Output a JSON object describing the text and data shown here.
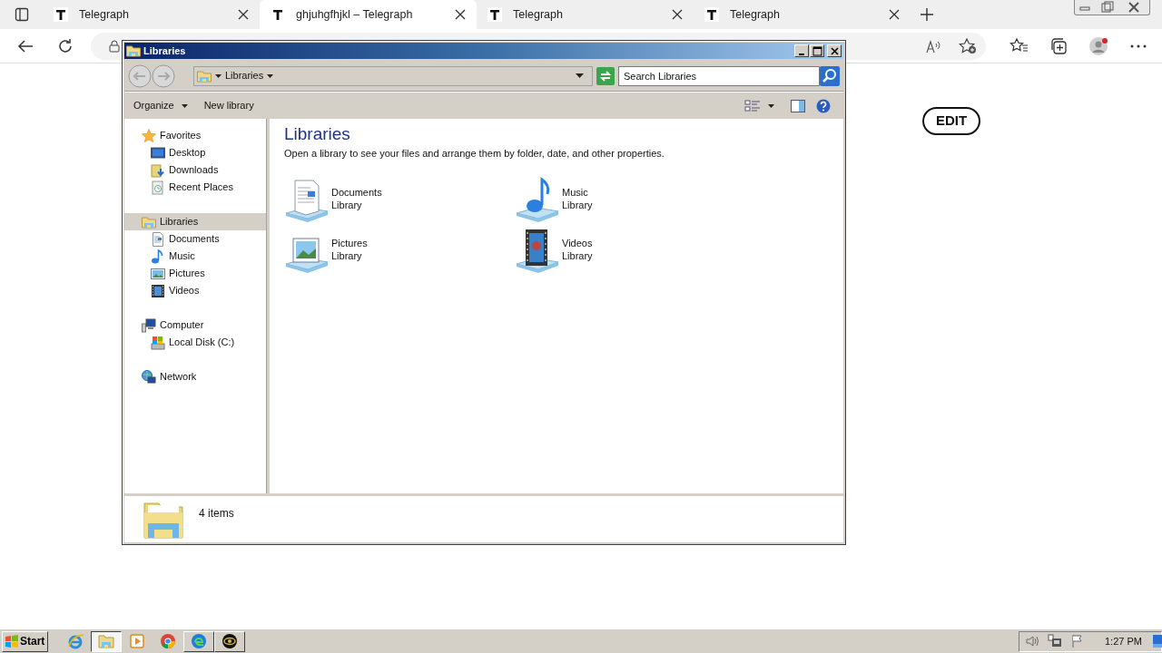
{
  "browser": {
    "tabs": [
      {
        "title": "Telegraph",
        "selected": false
      },
      {
        "title": "ghjuhgfhjkl – Telegraph",
        "selected": true
      },
      {
        "title": "Telegraph",
        "selected": false
      },
      {
        "title": "Telegraph",
        "selected": false
      }
    ]
  },
  "page": {
    "edit_button": "EDIT"
  },
  "explorer": {
    "title": "Libraries",
    "address": "Libraries",
    "search": {
      "placeholder": "Search Libraries"
    },
    "toolbar": [
      {
        "label": "Organize",
        "menu": true
      },
      {
        "label": "New library",
        "menu": false
      }
    ],
    "nav": [
      {
        "label": "Favorites",
        "kind": "star",
        "selected": false,
        "children": [
          {
            "label": "Desktop",
            "kind": "desktop",
            "selected": false
          },
          {
            "label": "Downloads",
            "kind": "downloads",
            "selected": false
          },
          {
            "label": "Recent Places",
            "kind": "recent",
            "selected": false
          }
        ]
      },
      {
        "label": "Libraries",
        "kind": "library",
        "selected": true,
        "children": [
          {
            "label": "Documents",
            "kind": "document",
            "selected": false
          },
          {
            "label": "Music",
            "kind": "music",
            "selected": false
          },
          {
            "label": "Pictures",
            "kind": "picture",
            "selected": false
          },
          {
            "label": "Videos",
            "kind": "video",
            "selected": false
          }
        ]
      },
      {
        "label": "Computer",
        "kind": "computer",
        "selected": false,
        "children": [
          {
            "label": "Local Disk (C:)",
            "kind": "disk",
            "selected": false
          }
        ]
      },
      {
        "label": "Network",
        "kind": "network",
        "selected": false
      }
    ],
    "heading": "Libraries",
    "description": "Open a library to see your files and arrange them by folder, date, and other properties.",
    "libraries": [
      {
        "name": "Documents",
        "subtitle": "Library",
        "kind": "document"
      },
      {
        "name": "Music",
        "subtitle": "Library",
        "kind": "music"
      },
      {
        "name": "Pictures",
        "subtitle": "Library",
        "kind": "picture"
      },
      {
        "name": "Videos",
        "subtitle": "Library",
        "kind": "video"
      }
    ],
    "details": "4 items"
  },
  "taskbar": {
    "start": "Start",
    "apps": [
      {
        "kind": "ie",
        "selected": false,
        "open": false
      },
      {
        "kind": "explorer",
        "selected": true,
        "open": true
      },
      {
        "kind": "media",
        "selected": false,
        "open": false
      },
      {
        "kind": "chrome",
        "selected": false,
        "open": false
      },
      {
        "kind": "edge",
        "selected": false,
        "open": true
      },
      {
        "kind": "eye",
        "selected": false,
        "open": true
      }
    ],
    "clock": "1:27 PM"
  }
}
